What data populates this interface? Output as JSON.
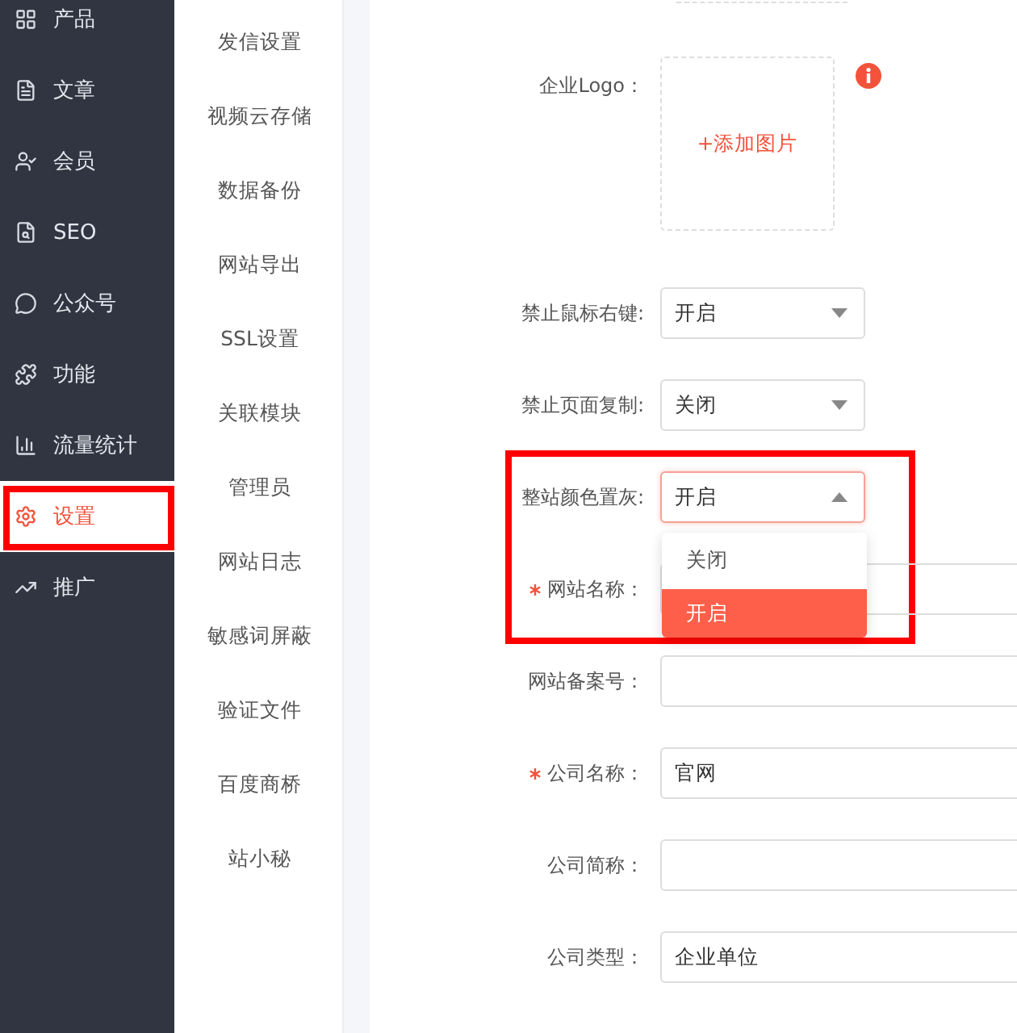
{
  "sidebar": {
    "items": [
      {
        "label": "产品",
        "selected": false,
        "highlighted": false
      },
      {
        "label": "文章",
        "selected": false,
        "highlighted": false
      },
      {
        "label": "会员",
        "selected": false,
        "highlighted": false
      },
      {
        "label": "SEO",
        "selected": false,
        "highlighted": false
      },
      {
        "label": "公众号",
        "selected": false,
        "highlighted": false
      },
      {
        "label": "功能",
        "selected": false,
        "highlighted": false
      },
      {
        "label": "流量统计",
        "selected": false,
        "highlighted": false
      },
      {
        "label": "设置",
        "selected": true,
        "highlighted": true
      },
      {
        "label": "推广",
        "selected": false,
        "highlighted": false
      }
    ]
  },
  "subnav": {
    "items": [
      {
        "label": "发信设置"
      },
      {
        "label": "视频云存储"
      },
      {
        "label": "数据备份"
      },
      {
        "label": "网站导出"
      },
      {
        "label": "SSL设置"
      },
      {
        "label": "关联模块"
      },
      {
        "label": "管理员"
      },
      {
        "label": "网站日志"
      },
      {
        "label": "敏感词屏蔽"
      },
      {
        "label": "验证文件"
      },
      {
        "label": "百度商桥"
      },
      {
        "label": "站小秘"
      }
    ]
  },
  "form": {
    "logo": {
      "label": "企业Logo：",
      "upload_text": "+添加图片"
    },
    "fields": [
      {
        "kind": "select",
        "label": "禁止鼠标右键:",
        "value": "开启",
        "open": false,
        "highlighted": false
      },
      {
        "kind": "select",
        "label": "禁止页面复制:",
        "value": "关闭",
        "open": false,
        "highlighted": false
      },
      {
        "kind": "select",
        "label": "整站颜色置灰:",
        "value": "开启",
        "open": true,
        "highlighted": true,
        "options": [
          {
            "label": "关闭",
            "selected": false
          },
          {
            "label": "开启",
            "selected": true
          }
        ]
      },
      {
        "kind": "input",
        "label": "网站名称：",
        "required": true
      },
      {
        "kind": "input",
        "label": "网站备案号：",
        "required": false
      },
      {
        "kind": "input",
        "label": "公司名称：",
        "value": "官网",
        "required": true
      },
      {
        "kind": "input",
        "label": "公司简称：",
        "required": false
      },
      {
        "kind": "input",
        "label": "公司类型：",
        "value": "企业单位",
        "required": false
      }
    ]
  }
}
